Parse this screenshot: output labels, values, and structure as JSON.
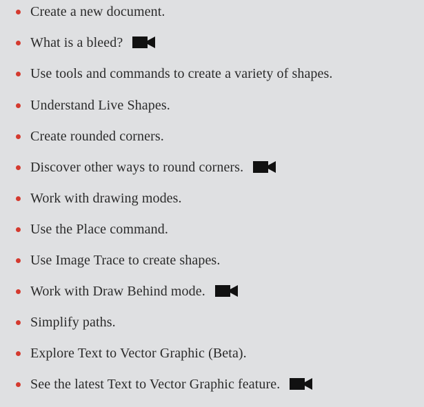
{
  "colors": {
    "background": "#dfe0e2",
    "bullet": "#d43a2f",
    "text": "#2b2b2b",
    "icon": "#111111"
  },
  "items": [
    {
      "text": "Create a new document.",
      "icon": ""
    },
    {
      "text": "What is a bleed?",
      "icon": "video-camera-icon"
    },
    {
      "text": "Use tools and commands to create a variety of shapes.",
      "icon": ""
    },
    {
      "text": "Understand Live Shapes.",
      "icon": ""
    },
    {
      "text": "Create rounded corners.",
      "icon": ""
    },
    {
      "text": "Discover other ways to round corners.",
      "icon": "video-camera-icon"
    },
    {
      "text": "Work with drawing modes.",
      "icon": ""
    },
    {
      "text": "Use the Place command.",
      "icon": ""
    },
    {
      "text": "Use Image Trace to create shapes.",
      "icon": ""
    },
    {
      "text": "Work with Draw Behind mode.",
      "icon": "video-camera-icon"
    },
    {
      "text": "Simplify paths.",
      "icon": ""
    },
    {
      "text": "Explore Text to Vector Graphic (Beta).",
      "icon": ""
    },
    {
      "text": "See the latest Text to Vector Graphic feature.",
      "icon": "video-camera-icon"
    }
  ]
}
